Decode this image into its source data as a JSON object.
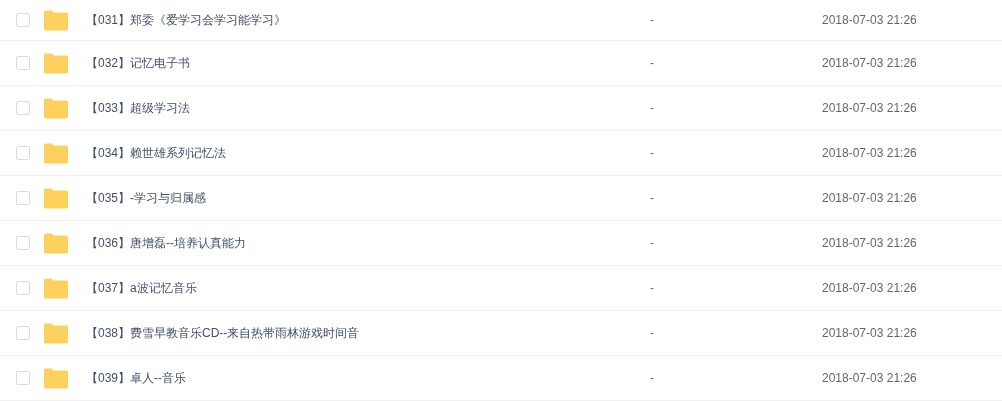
{
  "rows": [
    {
      "name": "【031】郑委《爱学习会学习能学习》",
      "checked": false,
      "size": "-",
      "modified": "2018-07-03 21:26"
    },
    {
      "name": "【032】记忆电子书",
      "checked": false,
      "size": "-",
      "modified": "2018-07-03 21:26"
    },
    {
      "name": "【033】超级学习法",
      "checked": false,
      "size": "-",
      "modified": "2018-07-03 21:26"
    },
    {
      "name": "【034】赖世雄系列记忆法",
      "checked": false,
      "size": "-",
      "modified": "2018-07-03 21:26"
    },
    {
      "name": "【035】-学习与归属感",
      "checked": false,
      "size": "-",
      "modified": "2018-07-03 21:26"
    },
    {
      "name": "【036】唐增磊--培养认真能力",
      "checked": false,
      "size": "-",
      "modified": "2018-07-03 21:26"
    },
    {
      "name": "【037】a波记忆音乐",
      "checked": false,
      "size": "-",
      "modified": "2018-07-03 21:26"
    },
    {
      "name": "【038】费雪早教音乐CD--来自热带雨林游戏时间音",
      "checked": false,
      "size": "-",
      "modified": "2018-07-03 21:26"
    },
    {
      "name": "【039】卓人--音乐",
      "checked": false,
      "size": "-",
      "modified": "2018-07-03 21:26"
    }
  ]
}
